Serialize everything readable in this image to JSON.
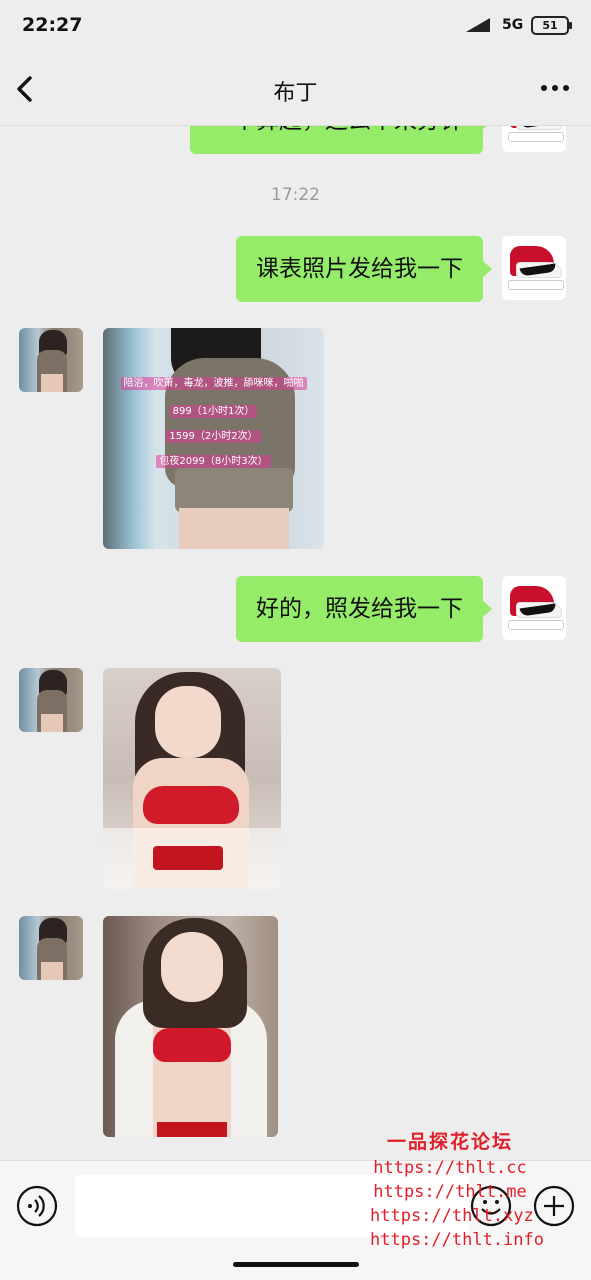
{
  "status_bar": {
    "time": "22:27",
    "network": "5G",
    "battery": "51"
  },
  "header": {
    "title": "布丁"
  },
  "chat": {
    "partial_message": "一个算起，这么个来分钟",
    "timestamp": "17:22",
    "messages": [
      {
        "side": "out",
        "text": "课表照片发给我一下"
      },
      {
        "side": "in",
        "type": "image",
        "overlay": [
          "陪浴，吹萧，毒龙，波推，舔咪咪，啪啪",
          "899（1小时1次）",
          "1599（2小时2次）",
          "包夜2099（8小时3次）"
        ]
      },
      {
        "side": "out",
        "text": "好的，照发给我一下"
      },
      {
        "side": "in",
        "type": "image"
      },
      {
        "side": "in",
        "type": "image"
      }
    ]
  },
  "input_bar": {
    "placeholder": ""
  },
  "watermark": {
    "title": "一品探花论坛",
    "urls": [
      "https://thlt.cc",
      "https://thlt.me",
      "https://thlt.xyz",
      "https://thlt.info"
    ]
  }
}
